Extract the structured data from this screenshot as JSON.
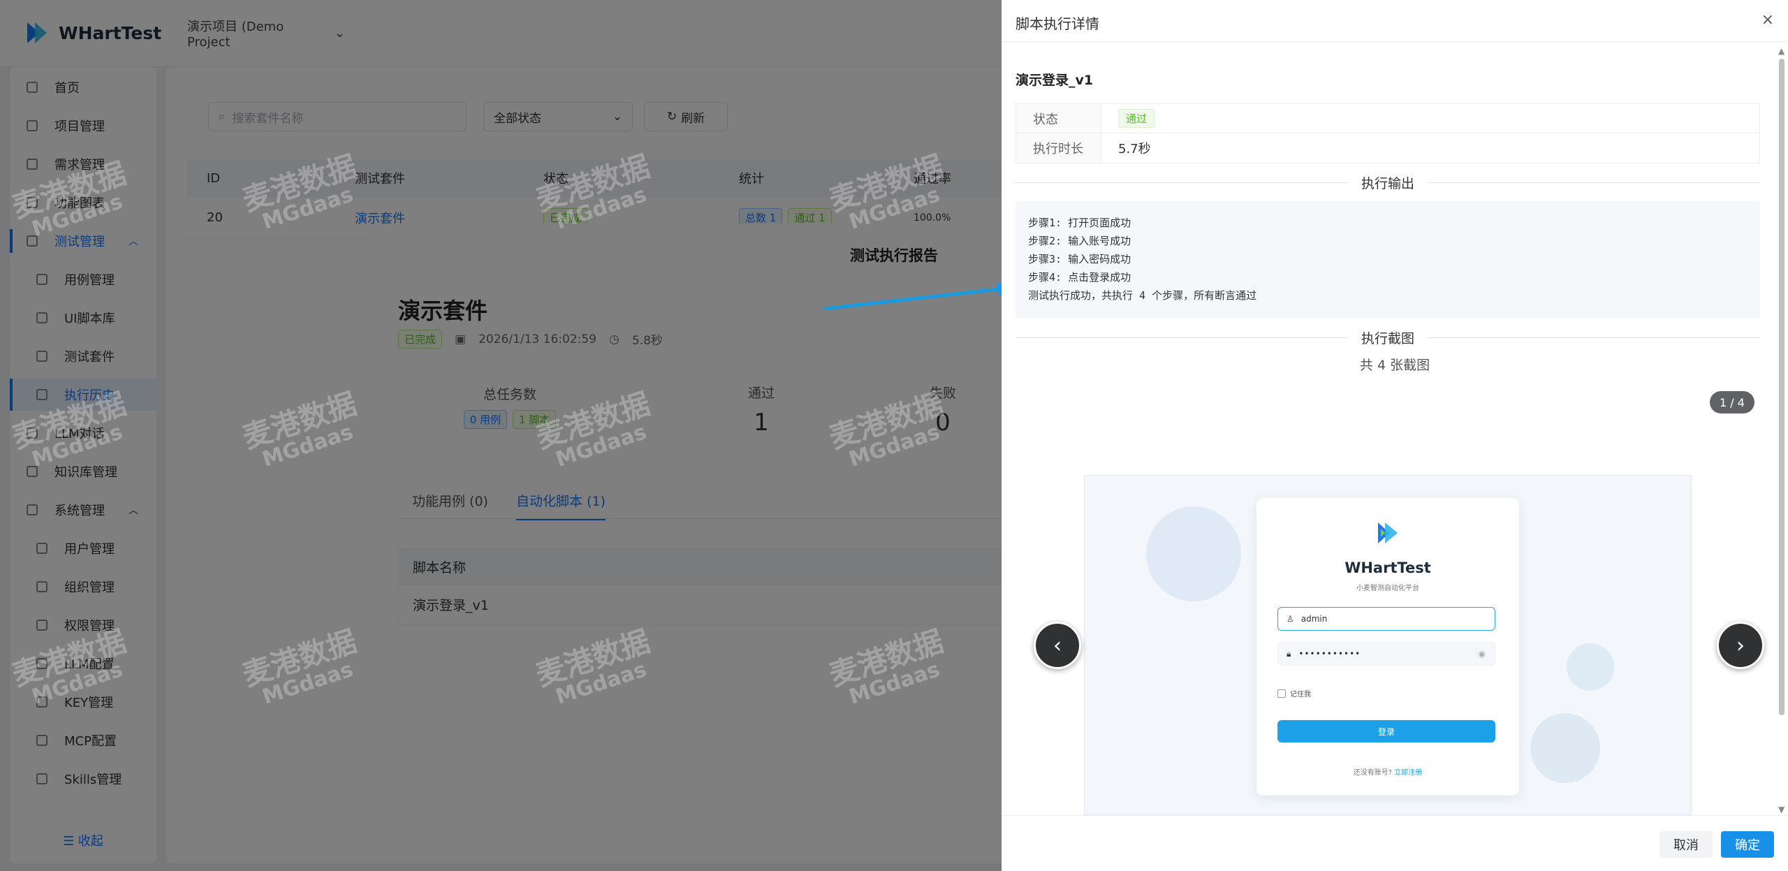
{
  "app": {
    "name": "WHartTest",
    "project": "演示项目 (Demo Project"
  },
  "sidebar": {
    "items": [
      {
        "label": "首页"
      },
      {
        "label": "项目管理"
      },
      {
        "label": "需求管理"
      },
      {
        "label": "功能图表"
      },
      {
        "label": "测试管理"
      },
      {
        "label": "用例管理"
      },
      {
        "label": "UI脚本库"
      },
      {
        "label": "测试套件"
      },
      {
        "label": "执行历史"
      },
      {
        "label": "LLM对话"
      },
      {
        "label": "知识库管理"
      },
      {
        "label": "系统管理"
      },
      {
        "label": "用户管理"
      },
      {
        "label": "组织管理"
      },
      {
        "label": "权限管理"
      },
      {
        "label": "LLM配置"
      },
      {
        "label": "KEY管理"
      },
      {
        "label": "MCP配置"
      },
      {
        "label": "Skills管理"
      }
    ],
    "collapse_label": "☰ 收起"
  },
  "list": {
    "search_placeholder": "搜索套件名称",
    "status_filter": "全部状态",
    "refresh_label": "刷新",
    "columns": [
      "ID",
      "测试套件",
      "状态",
      "统计",
      "通过率"
    ],
    "row": {
      "id": "20",
      "suite": "演示套件",
      "status": "已完成",
      "stat_total": "总数 1",
      "stat_pass": "通过 1",
      "rate": "100.0%"
    }
  },
  "report": {
    "title": "测试执行报告",
    "suite_name": "演示套件",
    "status_tag": "已完成",
    "datetime": "2026/1/13 16:02:59",
    "duration": "5.8秒",
    "stats": {
      "total_label": "总任务数",
      "total_case_tag": "0 用例",
      "total_script_tag": "1 脚本",
      "pass_label": "通过",
      "pass_value": "1",
      "fail_label": "失败",
      "fail_value": "0"
    },
    "tabs": [
      "功能用例 (0)",
      "自动化脚本 (1)"
    ],
    "script_col": "脚本名称",
    "script_row": "演示登录_v1"
  },
  "drawer": {
    "title": "脚本执行详情",
    "close": "×",
    "script_name": "演示登录_v1",
    "status_label": "状态",
    "status_value": "通过",
    "duration_label": "执行时长",
    "duration_value": "5.7秒",
    "output_title": "执行输出",
    "output_lines": [
      "步骤1: 打开页面成功",
      "步骤2: 输入账号成功",
      "步骤3: 输入密码成功",
      "步骤4: 点击登录成功",
      "测试执行成功，共执行 4 个步骤，所有断言通过"
    ],
    "screenshots_title": "执行截图",
    "screenshots_count": "共 4 张截图",
    "page_indicator": "1 / 4",
    "cancel": "取消",
    "confirm": "确定"
  },
  "screenshot": {
    "app_name": "WHartTest",
    "subtitle": "小麦智测自动化平台",
    "username": "admin",
    "password_mask": "•••••••••••",
    "remember": "记住我",
    "login_btn": "登录",
    "register_text": "还没有账号?",
    "register_link": "立即注册"
  },
  "watermark": {
    "cn": "麦港数据",
    "en": "MGdaas"
  },
  "colors": {
    "primary": "#1677ff",
    "success": "#52c41a",
    "drawer_confirm": "#1790e8"
  }
}
